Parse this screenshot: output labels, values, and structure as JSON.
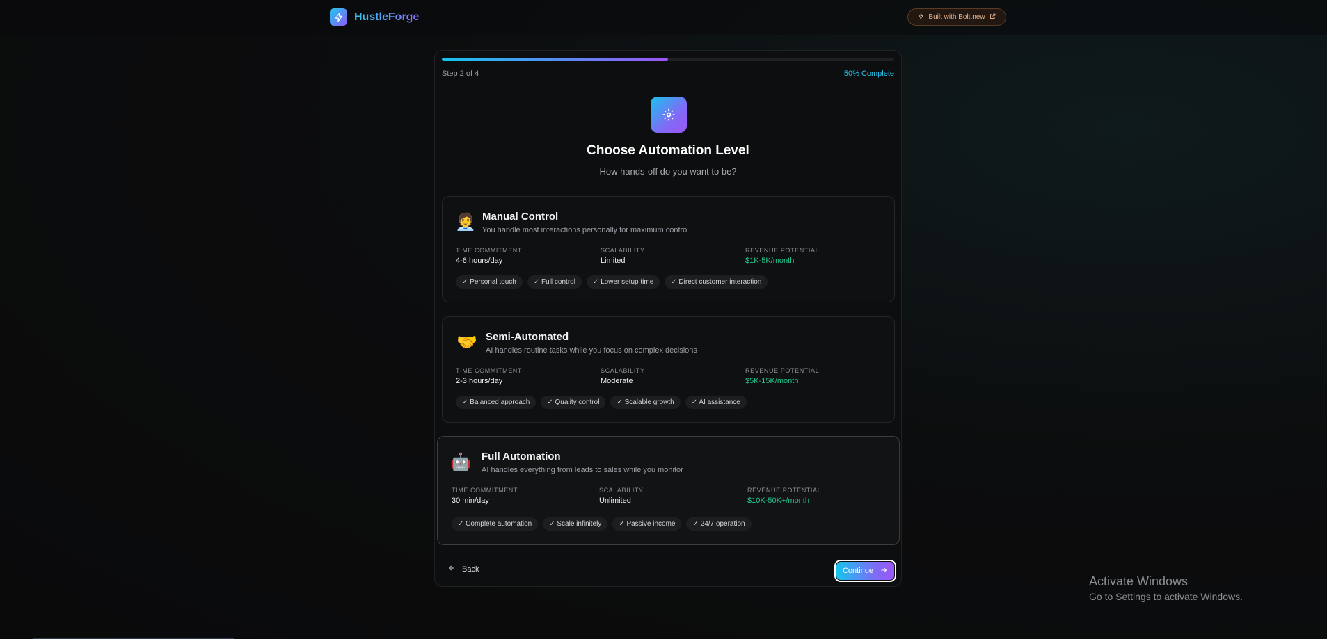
{
  "header": {
    "brand_name": "HustleForge",
    "badge_label": "Built with Bolt.new"
  },
  "progress": {
    "fraction": 0.5,
    "step_text": "Step 2 of 4",
    "percent_text": "50% Complete"
  },
  "page": {
    "title": "Choose Automation Level",
    "subtitle": "How hands-off do you want to be?"
  },
  "metric_labels": {
    "time": "TIME COMMITMENT",
    "scalability": "SCALABILITY",
    "revenue": "REVENUE POTENTIAL"
  },
  "options": [
    {
      "emoji": "🧑‍💼",
      "name": "Manual Control",
      "description": "You handle most interactions personally for maximum control",
      "time": "4-6 hours/day",
      "scalability": "Limited",
      "revenue": "$1K-5K/month",
      "features": [
        "✓ Personal touch",
        "✓ Full control",
        "✓ Lower setup time",
        "✓ Direct customer interaction"
      ]
    },
    {
      "emoji": "🤝",
      "name": "Semi-Automated",
      "description": "AI handles routine tasks while you focus on complex decisions",
      "time": "2-3 hours/day",
      "scalability": "Moderate",
      "revenue": "$5K-15K/month",
      "features": [
        "✓ Balanced approach",
        "✓ Quality control",
        "✓ Scalable growth",
        "✓ AI assistance"
      ]
    },
    {
      "emoji": "🤖",
      "name": "Full Automation",
      "description": "AI handles everything from leads to sales while you monitor",
      "time": "30 min/day",
      "scalability": "Unlimited",
      "revenue": "$10K-50K+/month",
      "features": [
        "✓ Complete automation",
        "✓ Scale infinitely",
        "✓ Passive income",
        "✓ 24/7 operation"
      ]
    }
  ],
  "nav": {
    "back_label": "Back",
    "continue_label": "Continue"
  },
  "watermark": {
    "line1": "Activate Windows",
    "line2": "Go to Settings to activate Windows."
  },
  "colors": {
    "accent_cyan": "#17c4ee",
    "accent_purple": "#9d55f7",
    "revenue_green": "#22c58e"
  },
  "icons": {
    "brand": "lightning-icon",
    "badge": "lightning-icon",
    "hero": "gear-icon",
    "back": "arrow-left-icon",
    "continue": "arrow-right-icon"
  }
}
